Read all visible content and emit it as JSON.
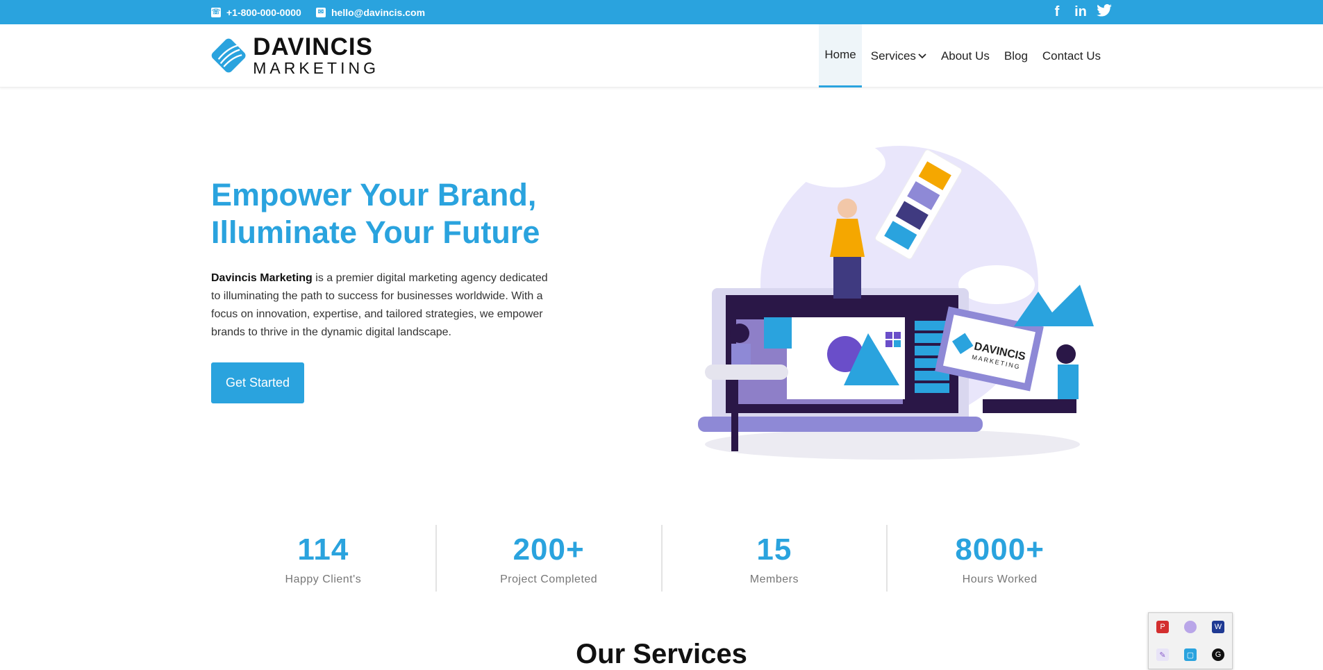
{
  "topbar": {
    "phone": "+1-800-000-0000",
    "email": "hello@davincis.com",
    "social": [
      {
        "icon": "facebook-icon",
        "glyph": "f"
      },
      {
        "icon": "linkedin-icon",
        "glyph": "in"
      },
      {
        "icon": "twitter-icon",
        "glyph": "t"
      }
    ]
  },
  "logo": {
    "line1": "DAVINCIS",
    "line2": "MARKETING"
  },
  "nav": {
    "items": [
      "Home",
      "Services",
      "About Us",
      "Blog",
      "Contact Us"
    ],
    "active": "Home"
  },
  "hero": {
    "title_line1": "Empower Your Brand,",
    "title_line2": "Illuminate Your Future",
    "brand": "Davincis Marketing",
    "text": " is a premier digital marketing agency dedicated to illuminating the path to success for businesses worldwide. With a focus on innovation, expertise, and tailored strategies, we empower brands to thrive in the dynamic digital landscape.",
    "cta": "Get Started",
    "illustration_logo_line1": "DAVINCIS",
    "illustration_logo_line2": "MARKETING"
  },
  "stats": [
    {
      "value": "114",
      "label": "Happy Client's"
    },
    {
      "value": "200+",
      "label": "Project Completed"
    },
    {
      "value": "15",
      "label": "Members"
    },
    {
      "value": "8000+",
      "label": "Hours Worked"
    }
  ],
  "services": {
    "title": "Our Services"
  },
  "colors": {
    "accent": "#2aa3de",
    "text_dark": "#111111",
    "muted": "#777777"
  }
}
